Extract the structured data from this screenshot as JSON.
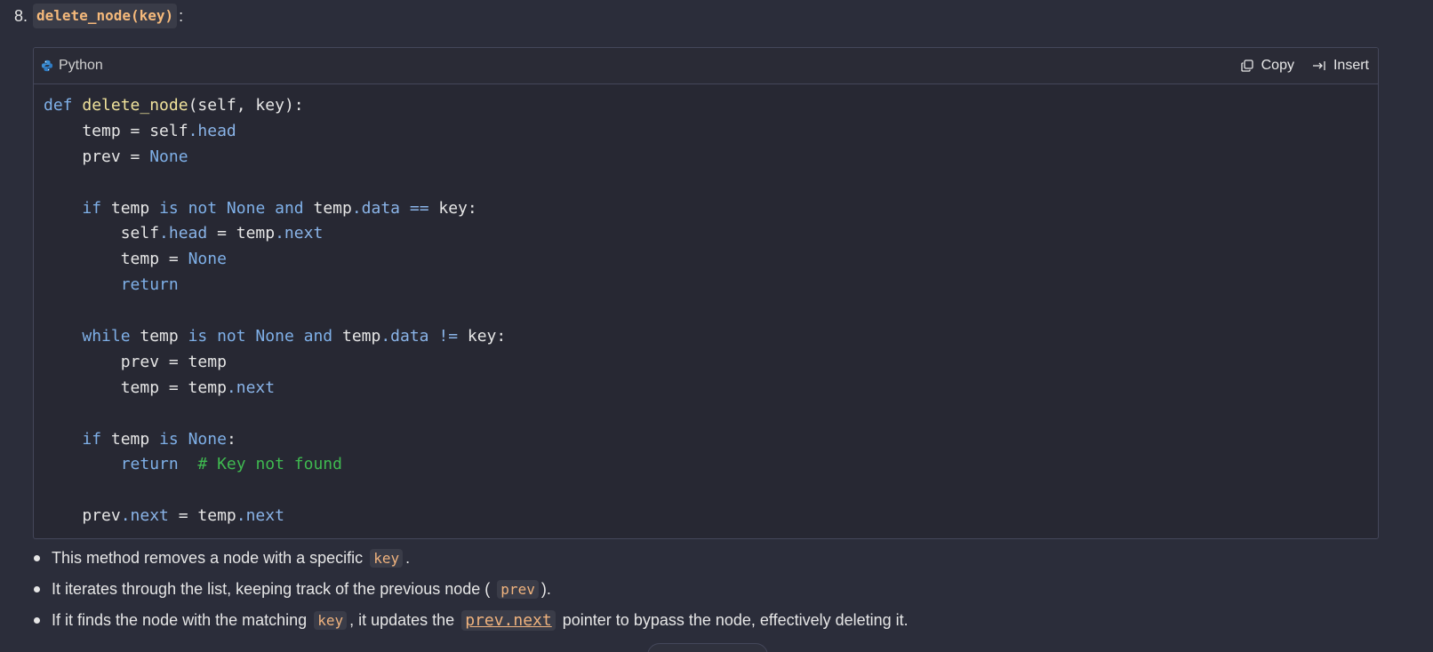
{
  "heading": {
    "number": "8.",
    "code": "delete_node(key)",
    "suffix": ":"
  },
  "code_block": {
    "language": "Python",
    "copy_label": "Copy",
    "insert_label": "Insert",
    "lines": [
      [
        {
          "t": "def",
          "c": "kw"
        },
        {
          "t": " "
        },
        {
          "t": "delete_node",
          "c": "fn"
        },
        {
          "t": "(self, key):"
        }
      ],
      [
        {
          "t": "    temp = self"
        },
        {
          "t": ".head",
          "c": "attr"
        }
      ],
      [
        {
          "t": "    prev = "
        },
        {
          "t": "None",
          "c": "kw"
        }
      ],
      [],
      [
        {
          "t": "    "
        },
        {
          "t": "if",
          "c": "kw"
        },
        {
          "t": " temp "
        },
        {
          "t": "is not None and",
          "c": "kw"
        },
        {
          "t": " temp"
        },
        {
          "t": ".data",
          "c": "attr"
        },
        {
          "t": " "
        },
        {
          "t": "==",
          "c": "attr"
        },
        {
          "t": " key:"
        }
      ],
      [
        {
          "t": "        self"
        },
        {
          "t": ".head",
          "c": "attr"
        },
        {
          "t": " = temp"
        },
        {
          "t": ".next",
          "c": "attr"
        }
      ],
      [
        {
          "t": "        temp = "
        },
        {
          "t": "None",
          "c": "kw"
        }
      ],
      [
        {
          "t": "        "
        },
        {
          "t": "return",
          "c": "kw"
        }
      ],
      [],
      [
        {
          "t": "    "
        },
        {
          "t": "while",
          "c": "kw"
        },
        {
          "t": " temp "
        },
        {
          "t": "is not None and",
          "c": "kw"
        },
        {
          "t": " temp"
        },
        {
          "t": ".data",
          "c": "attr"
        },
        {
          "t": " "
        },
        {
          "t": "!=",
          "c": "attr"
        },
        {
          "t": " key:"
        }
      ],
      [
        {
          "t": "        prev = temp"
        }
      ],
      [
        {
          "t": "        temp = temp"
        },
        {
          "t": ".next",
          "c": "attr"
        }
      ],
      [],
      [
        {
          "t": "    "
        },
        {
          "t": "if",
          "c": "kw"
        },
        {
          "t": " temp "
        },
        {
          "t": "is None",
          "c": "kw"
        },
        {
          "t": ":"
        }
      ],
      [
        {
          "t": "        "
        },
        {
          "t": "return",
          "c": "kw"
        },
        {
          "t": "  "
        },
        {
          "t": "# Key not found",
          "c": "cm"
        }
      ],
      [],
      [
        {
          "t": "    prev"
        },
        {
          "t": ".next",
          "c": "attr"
        },
        {
          "t": " = temp"
        },
        {
          "t": ".next",
          "c": "attr"
        }
      ]
    ]
  },
  "bullets": [
    {
      "before": "This method removes a node with a specific",
      "code": "key",
      "after": "."
    },
    {
      "before": "It iterates through the list, keeping track of the previous node (",
      "code": "prev",
      "after": ")."
    },
    {
      "before": "If it finds the node with the matching",
      "code": "key",
      "middle": ", it updates the",
      "code2": "prev.next",
      "after": "pointer to bypass the node, effectively deleting it."
    }
  ],
  "colors": {
    "background": "#2b2d3a",
    "code_background": "#272833",
    "keyword": "#7fb0e8",
    "function": "#f1e39c",
    "comment": "#3fb950",
    "inline_code": "#f0b37e"
  }
}
